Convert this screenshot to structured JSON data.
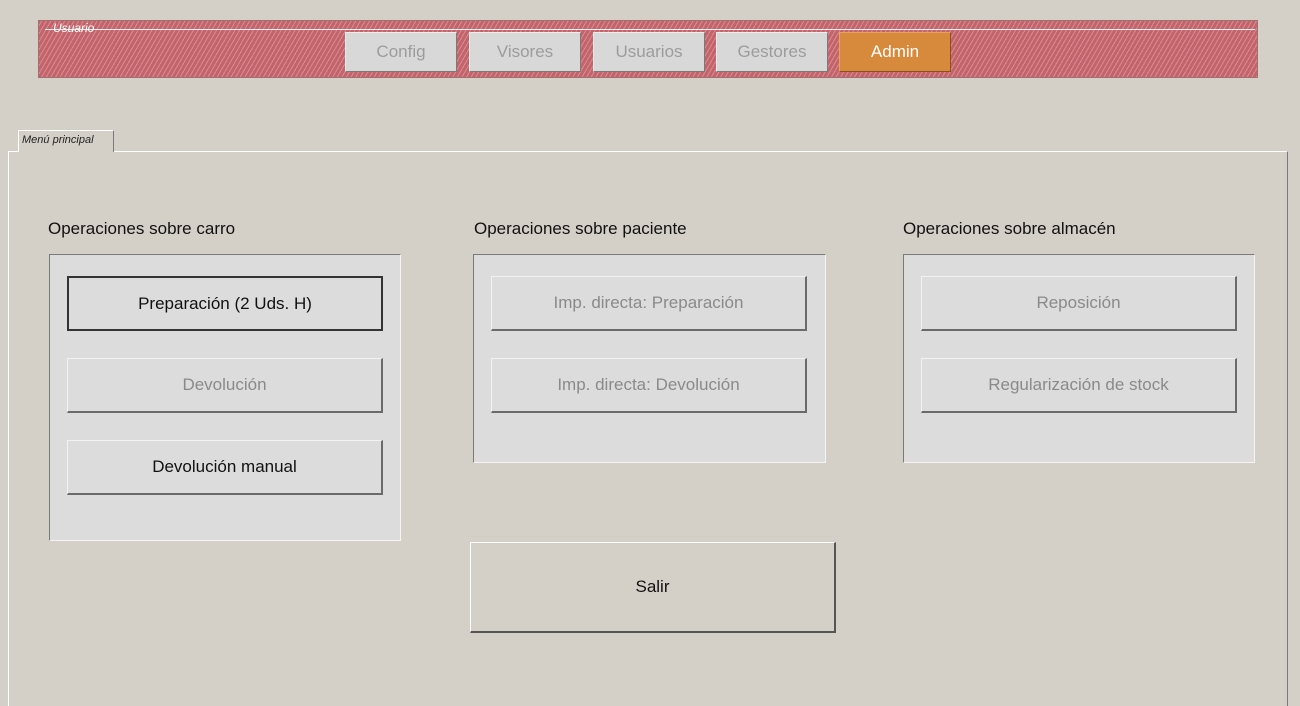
{
  "user_panel": {
    "label": "Usuario",
    "buttons": [
      {
        "label": "Config"
      },
      {
        "label": "Visores"
      },
      {
        "label": "Usuarios"
      },
      {
        "label": "Gestores"
      },
      {
        "label": "Admin",
        "active": true
      }
    ]
  },
  "tab": {
    "label": "Menú principal"
  },
  "groups": {
    "carro": {
      "title": "Operaciones sobre carro",
      "buttons": [
        "Preparación (2 Uds. H)",
        "Devolución",
        "Devolución manual"
      ]
    },
    "paciente": {
      "title": "Operaciones sobre paciente",
      "buttons": [
        "Imp. directa: Preparación",
        "Imp. directa: Devolución"
      ]
    },
    "almacen": {
      "title": "Operaciones sobre almacén",
      "buttons": [
        "Reposición",
        "Regularización de stock"
      ]
    }
  },
  "exit": {
    "label": "Salir"
  },
  "colors": {
    "accent": "#d88a3c",
    "user_panel_bg": "#c4636a",
    "window_bg": "#d4d0c8"
  }
}
